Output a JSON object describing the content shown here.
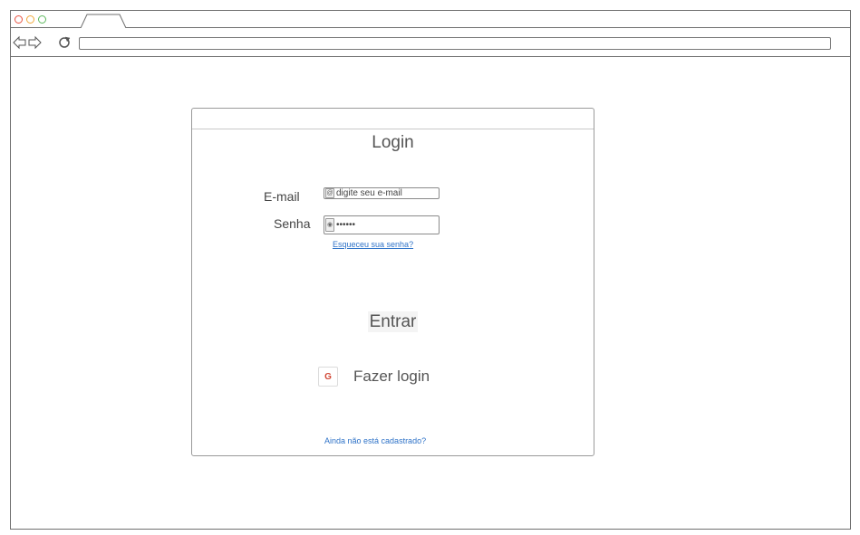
{
  "browser": {
    "traffic_lights": {
      "close_color": "#e8503f",
      "minimize_color": "#f0a83a",
      "maximize_color": "#5cb85c"
    }
  },
  "login": {
    "title": "Login",
    "email_label": "E-mail",
    "email_placeholder": "digite seu e-mail",
    "password_label": "Senha",
    "password_value": "••••••",
    "forgot_link": "Esqueceu sua senha?",
    "submit_label": "Entrar",
    "google_icon_letter": "G",
    "google_label": "Fazer login",
    "signup_link": "Ainda não está cadastrado?"
  },
  "icons": {
    "email_field_icon": "at-icon",
    "password_field_icon": "lock-icon",
    "google_icon": "google-icon"
  },
  "colors": {
    "link": "#2f73c8",
    "border": "#6f6f6f"
  }
}
